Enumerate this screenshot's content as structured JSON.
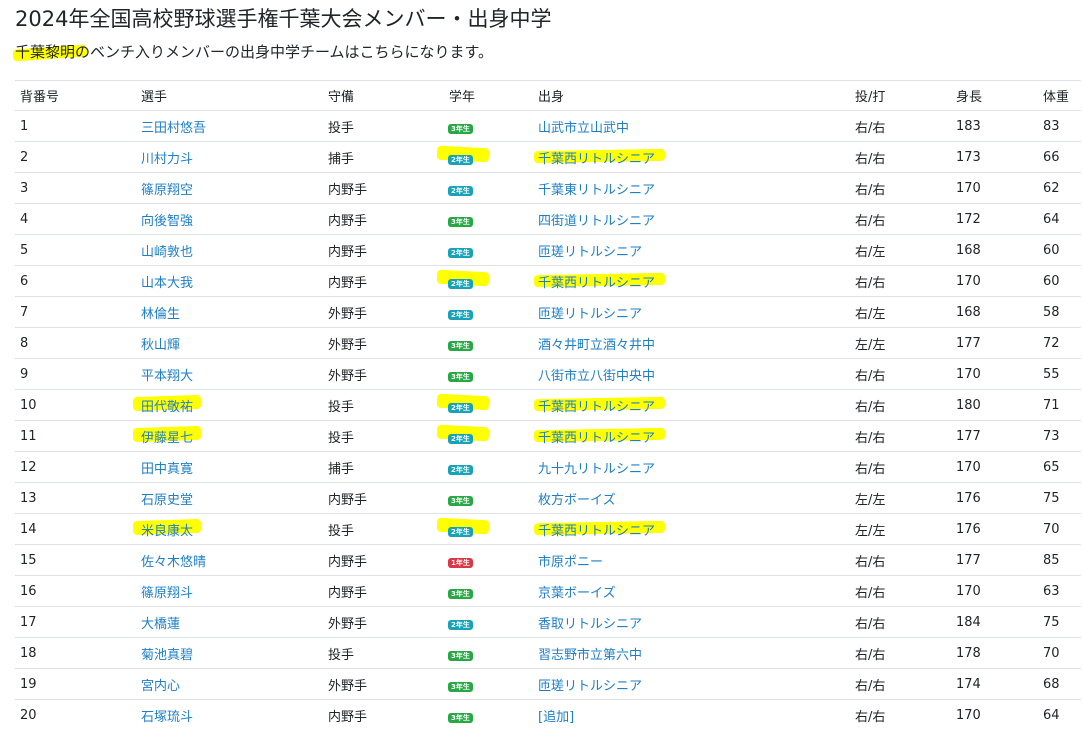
{
  "page": {
    "title": "2024年全国高校野球選手権千葉大会メンバー・出身中学",
    "subtitle": "千葉黎明のベンチ入りメンバーの出身中学チームはこちらになります。",
    "highlight_color": "#ffff00",
    "link_color": "#1e7fc7"
  },
  "table": {
    "headers": {
      "number": "背番号",
      "name": "選手",
      "position": "守備",
      "year": "学年",
      "origin": "出身",
      "throw_bat": "投/打",
      "height": "身長",
      "weight": "体重"
    },
    "rows": [
      {
        "number": "1",
        "name": "三田村悠吾",
        "position": "投手",
        "year": "3年生",
        "origin": "山武市立山武中",
        "throw_bat": "右/右",
        "height": "183",
        "weight": "83",
        "highlight_name": false,
        "highlight_year": false,
        "highlight_origin": false
      },
      {
        "number": "2",
        "name": "川村力斗",
        "position": "捕手",
        "year": "2年生",
        "origin": "千葉西リトルシニア",
        "throw_bat": "右/右",
        "height": "173",
        "weight": "66",
        "highlight_name": false,
        "highlight_year": true,
        "highlight_origin": true
      },
      {
        "number": "3",
        "name": "篠原翔空",
        "position": "内野手",
        "year": "2年生",
        "origin": "千葉東リトルシニア",
        "throw_bat": "右/右",
        "height": "170",
        "weight": "62",
        "highlight_name": false,
        "highlight_year": false,
        "highlight_origin": false
      },
      {
        "number": "4",
        "name": "向後智強",
        "position": "内野手",
        "year": "3年生",
        "origin": "四街道リトルシニア",
        "throw_bat": "右/右",
        "height": "172",
        "weight": "64",
        "highlight_name": false,
        "highlight_year": false,
        "highlight_origin": false
      },
      {
        "number": "5",
        "name": "山崎敦也",
        "position": "内野手",
        "year": "2年生",
        "origin": "匝瑳リトルシニア",
        "throw_bat": "右/左",
        "height": "168",
        "weight": "60",
        "highlight_name": false,
        "highlight_year": false,
        "highlight_origin": false
      },
      {
        "number": "6",
        "name": "山本大我",
        "position": "内野手",
        "year": "2年生",
        "origin": "千葉西リトルシニア",
        "throw_bat": "右/右",
        "height": "170",
        "weight": "60",
        "highlight_name": false,
        "highlight_year": true,
        "highlight_origin": true
      },
      {
        "number": "7",
        "name": "林倫生",
        "position": "外野手",
        "year": "2年生",
        "origin": "匝瑳リトルシニア",
        "throw_bat": "右/左",
        "height": "168",
        "weight": "58",
        "highlight_name": false,
        "highlight_year": false,
        "highlight_origin": false
      },
      {
        "number": "8",
        "name": "秋山輝",
        "position": "外野手",
        "year": "3年生",
        "origin": "酒々井町立酒々井中",
        "throw_bat": "左/左",
        "height": "177",
        "weight": "72",
        "highlight_name": false,
        "highlight_year": false,
        "highlight_origin": false
      },
      {
        "number": "9",
        "name": "平本翔大",
        "position": "外野手",
        "year": "3年生",
        "origin": "八街市立八街中央中",
        "throw_bat": "右/右",
        "height": "170",
        "weight": "55",
        "highlight_name": false,
        "highlight_year": false,
        "highlight_origin": false
      },
      {
        "number": "10",
        "name": "田代敬祐",
        "position": "投手",
        "year": "2年生",
        "origin": "千葉西リトルシニア",
        "throw_bat": "右/右",
        "height": "180",
        "weight": "71",
        "highlight_name": true,
        "highlight_year": true,
        "highlight_origin": true
      },
      {
        "number": "11",
        "name": "伊藤星七",
        "position": "投手",
        "year": "2年生",
        "origin": "千葉西リトルシニア",
        "throw_bat": "右/右",
        "height": "177",
        "weight": "73",
        "highlight_name": true,
        "highlight_year": true,
        "highlight_origin": true
      },
      {
        "number": "12",
        "name": "田中真寛",
        "position": "捕手",
        "year": "2年生",
        "origin": "九十九リトルシニア",
        "throw_bat": "右/右",
        "height": "170",
        "weight": "65",
        "highlight_name": false,
        "highlight_year": false,
        "highlight_origin": false
      },
      {
        "number": "13",
        "name": "石原史堂",
        "position": "内野手",
        "year": "3年生",
        "origin": "枚方ボーイズ",
        "throw_bat": "左/左",
        "height": "176",
        "weight": "75",
        "highlight_name": false,
        "highlight_year": false,
        "highlight_origin": false
      },
      {
        "number": "14",
        "name": "米良康太",
        "position": "投手",
        "year": "2年生",
        "origin": "千葉西リトルシニア",
        "throw_bat": "左/左",
        "height": "176",
        "weight": "70",
        "highlight_name": true,
        "highlight_year": true,
        "highlight_origin": true
      },
      {
        "number": "15",
        "name": "佐々木悠晴",
        "position": "内野手",
        "year": "1年生",
        "origin": "市原ポニー",
        "throw_bat": "右/右",
        "height": "177",
        "weight": "85",
        "highlight_name": false,
        "highlight_year": false,
        "highlight_origin": false
      },
      {
        "number": "16",
        "name": "篠原翔斗",
        "position": "内野手",
        "year": "3年生",
        "origin": "京葉ボーイズ",
        "throw_bat": "右/右",
        "height": "170",
        "weight": "63",
        "highlight_name": false,
        "highlight_year": false,
        "highlight_origin": false
      },
      {
        "number": "17",
        "name": "大橋蓮",
        "position": "外野手",
        "year": "2年生",
        "origin": "香取リトルシニア",
        "throw_bat": "右/右",
        "height": "184",
        "weight": "75",
        "highlight_name": false,
        "highlight_year": false,
        "highlight_origin": false
      },
      {
        "number": "18",
        "name": "菊池真碧",
        "position": "投手",
        "year": "3年生",
        "origin": "習志野市立第六中",
        "throw_bat": "右/右",
        "height": "178",
        "weight": "70",
        "highlight_name": false,
        "highlight_year": false,
        "highlight_origin": false
      },
      {
        "number": "19",
        "name": "宮内心",
        "position": "外野手",
        "year": "3年生",
        "origin": "匝瑳リトルシニア",
        "throw_bat": "右/右",
        "height": "174",
        "weight": "68",
        "highlight_name": false,
        "highlight_year": false,
        "highlight_origin": false
      },
      {
        "number": "20",
        "name": "石塚琉斗",
        "position": "内野手",
        "year": "3年生",
        "origin": "[追加]",
        "throw_bat": "右/右",
        "height": "170",
        "weight": "64",
        "highlight_name": false,
        "highlight_year": false,
        "highlight_origin": false
      }
    ]
  }
}
